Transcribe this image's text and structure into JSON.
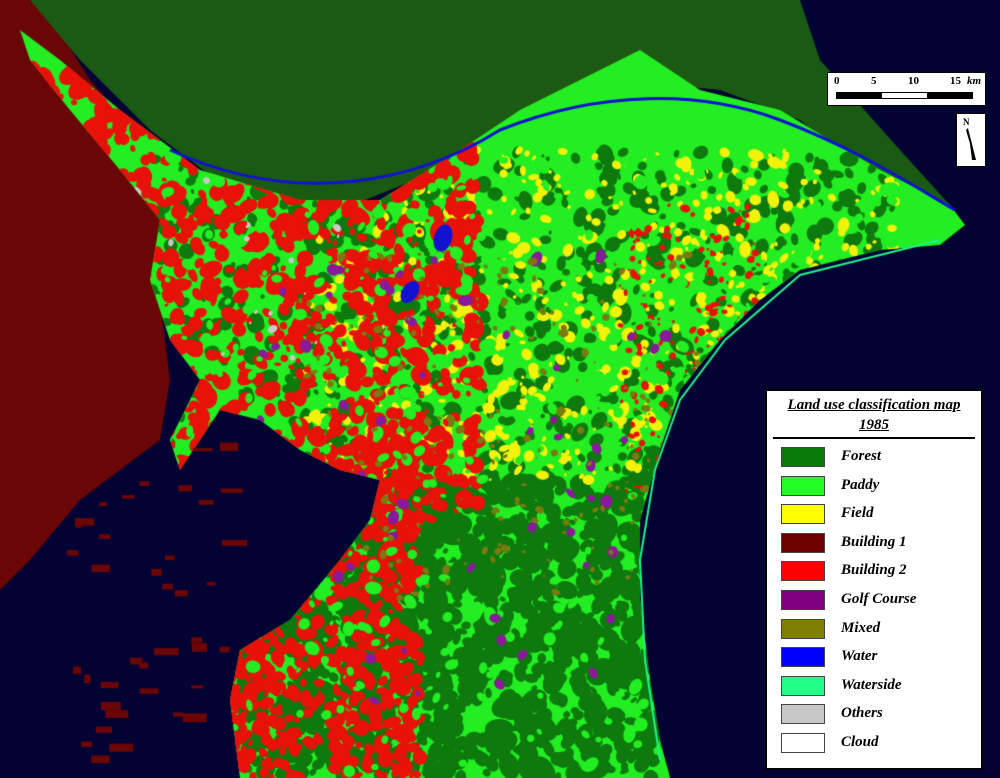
{
  "map": {
    "colors": {
      "sea": "#020233",
      "forest": "#0e7a0e",
      "paddy": "#22ee22",
      "field": "#f2f20a",
      "building1": "#6a0606",
      "building2": "#e8120a",
      "golf": "#8a1a9a",
      "mixed": "#7a7a10",
      "water": "#1212d0",
      "waterside": "#22f08a",
      "others": "#c8c8c8"
    }
  },
  "scale": {
    "ticks": [
      "0",
      "5",
      "10",
      "15"
    ],
    "unit": "km"
  },
  "north": {
    "label": "N",
    "icon": "north-arrow-icon"
  },
  "legend": {
    "title_line1": "Land use classification map",
    "title_line2": "1985",
    "items": [
      {
        "label": "Forest",
        "color": "#0a7a0a"
      },
      {
        "label": "Paddy",
        "color": "#22ff22"
      },
      {
        "label": "Field",
        "color": "#ffff00"
      },
      {
        "label": "Building 1",
        "color": "#6e0000"
      },
      {
        "label": "Building 2",
        "color": "#ff0000"
      },
      {
        "label": "Golf Course",
        "color": "#800080"
      },
      {
        "label": "Mixed",
        "color": "#808000"
      },
      {
        "label": "Water",
        "color": "#0000ff"
      },
      {
        "label": "Waterside",
        "color": "#22ff88"
      },
      {
        "label": "Others",
        "color": "#c8c8c8"
      },
      {
        "label": "Cloud",
        "color": "#ffffff"
      }
    ]
  }
}
